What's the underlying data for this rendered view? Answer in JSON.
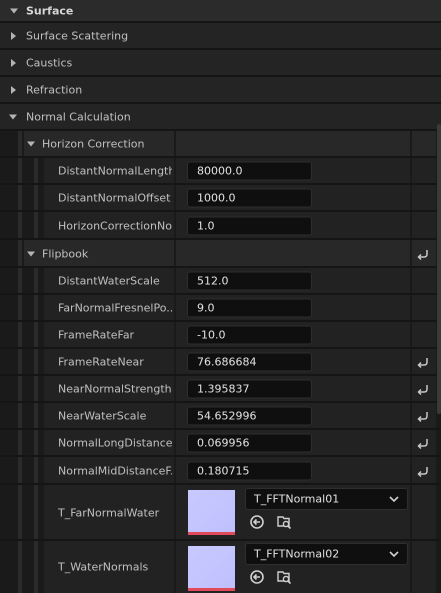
{
  "sections": {
    "surface": "Surface",
    "surface_scattering": "Surface Scattering",
    "caustics": "Caustics",
    "refraction": "Refraction",
    "normal_calculation": "Normal Calculation"
  },
  "groups": {
    "horizon_correction": "Horizon Correction",
    "flipbook": "Flipbook"
  },
  "horizon": [
    {
      "label": "DistantNormalLength",
      "value": "80000.0"
    },
    {
      "label": "DistantNormalOffset",
      "value": "1000.0"
    },
    {
      "label": "HorizonCorrectionNo...",
      "value": "1.0"
    }
  ],
  "flipbook": [
    {
      "label": "DistantWaterScale",
      "value": "512.0"
    },
    {
      "label": "FarNormalFresnelPo...",
      "value": "9.0"
    },
    {
      "label": "FrameRateFar",
      "value": "-10.0"
    },
    {
      "label": "FrameRateNear",
      "value": "76.686684"
    },
    {
      "label": "NearNormalStrength",
      "value": "1.395837"
    },
    {
      "label": "NearWaterScale",
      "value": "54.652996"
    },
    {
      "label": "NormalLongDistance...",
      "value": "0.069956"
    },
    {
      "label": "NormalMidDistanceF...",
      "value": "0.180715"
    }
  ],
  "textures": [
    {
      "label": "T_FarNormalWater",
      "asset": "T_FFTNormal01"
    },
    {
      "label": "T_WaterNormals",
      "asset": "T_FFTNormal02"
    }
  ],
  "icons": {
    "reset": "reset-arrow-icon",
    "use_selected": "use-selected-asset-icon",
    "browse": "browse-asset-icon",
    "dropdown": "chevron-down-icon",
    "expand": "caret-right-icon",
    "collapse": "caret-down-icon"
  },
  "colors": {
    "panel_bg": "#151515",
    "header_bg": "#242424",
    "row_bg": "#222222",
    "input_bg": "#0f0f0f",
    "text": "#c0c0c0",
    "value_text": "#e2e2e2",
    "thumb": "#c4c4ff",
    "thumb_underline": "#e04a5a"
  }
}
